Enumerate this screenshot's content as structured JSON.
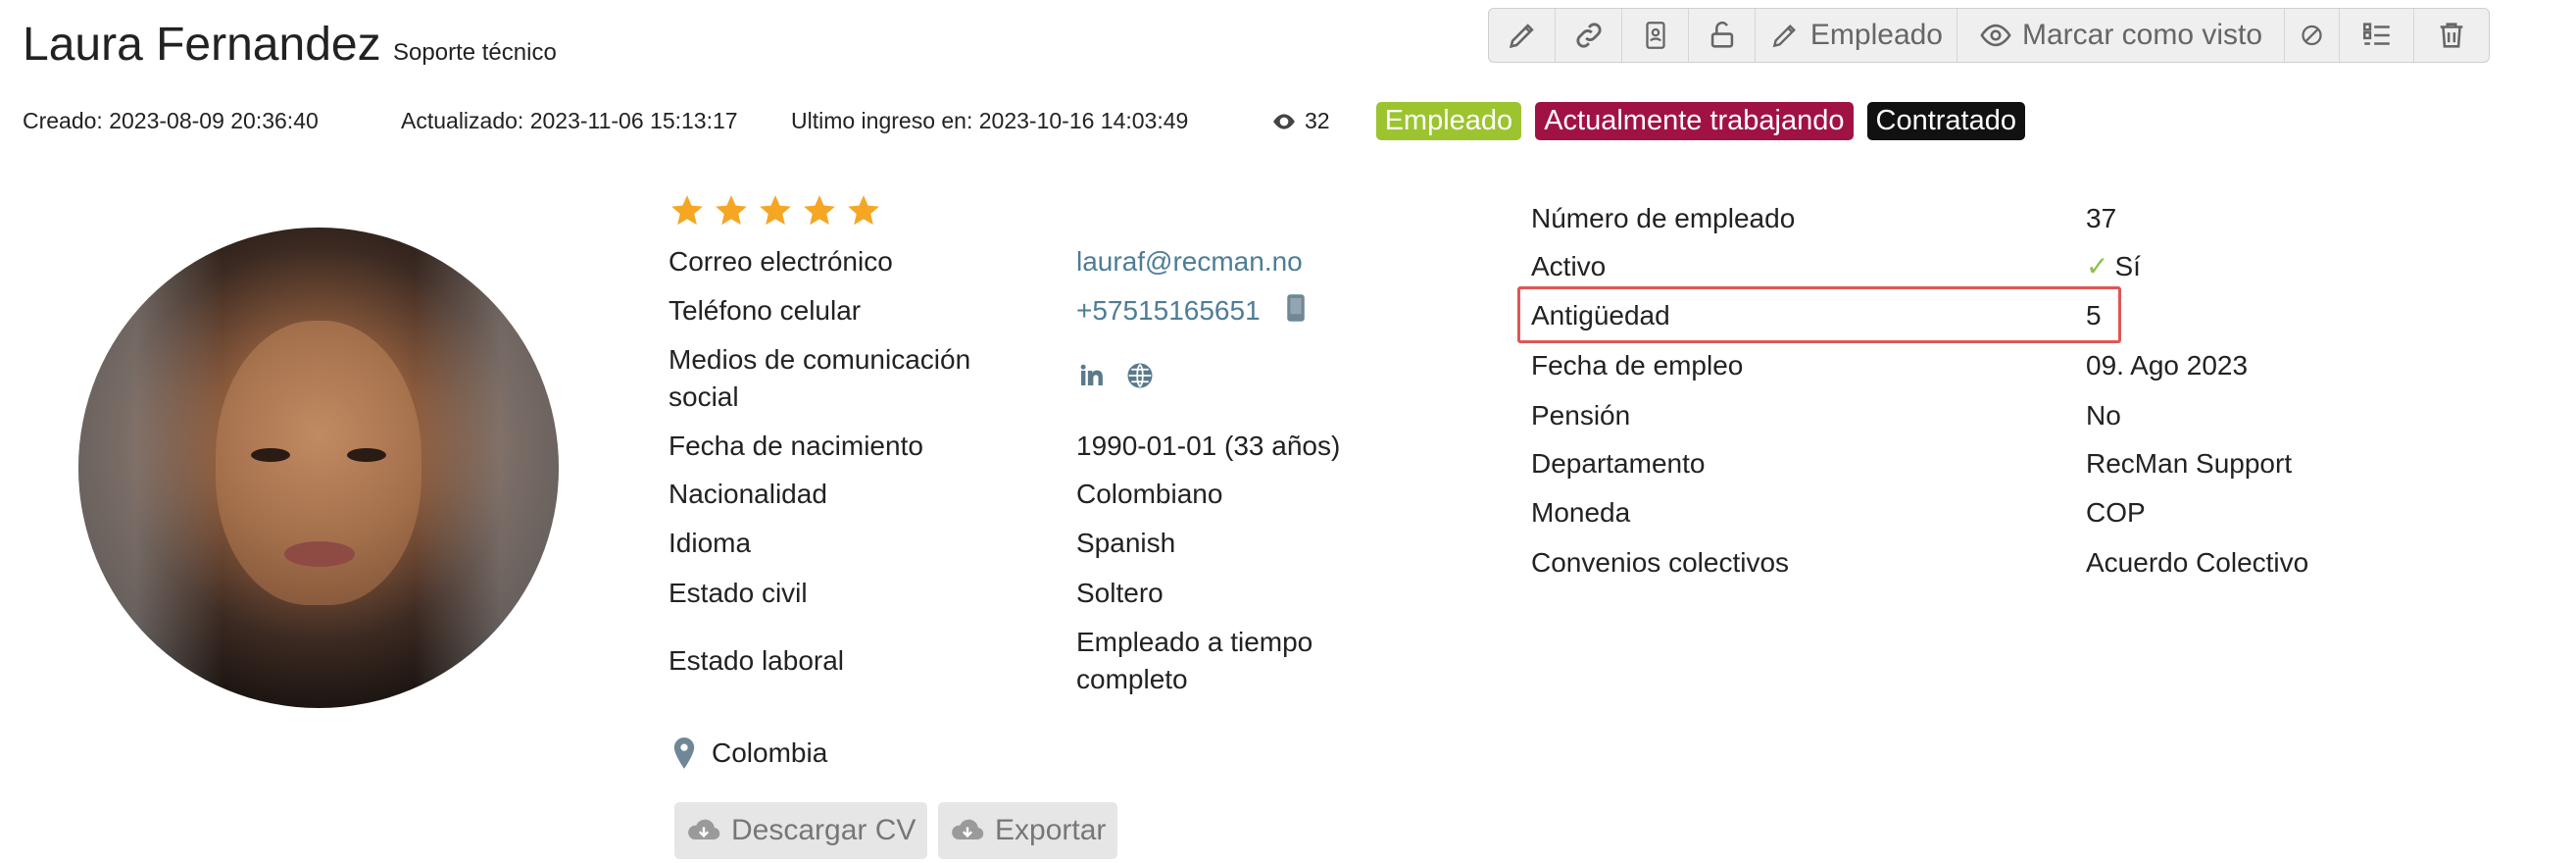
{
  "header": {
    "name": "Laura Fernandez",
    "subtitle": "Soporte técnico"
  },
  "toolbar": {
    "items": [
      {
        "icon": "pencil-icon"
      },
      {
        "icon": "link-icon"
      },
      {
        "icon": "contact-card-icon"
      },
      {
        "icon": "unlock-icon"
      },
      {
        "icon": "pencil-icon",
        "label": "Empleado"
      },
      {
        "icon": "eye-icon",
        "label": "Marcar como visto"
      },
      {
        "icon": "block-icon"
      },
      {
        "icon": "list-icon"
      },
      {
        "icon": "trash-icon"
      }
    ]
  },
  "meta": {
    "created": "Creado: 2023-08-09 20:36:40",
    "updated": "Actualizado: 2023-11-06 15:13:17",
    "last_login": "Ultimo ingreso en: 2023-10-16 14:03:49",
    "views": "32"
  },
  "badges": [
    {
      "label": "Empleado",
      "color": "#9cc42e"
    },
    {
      "label": "Actualmente trabajando",
      "color": "#a11244"
    },
    {
      "label": "Contratado",
      "color": "#111111"
    }
  ],
  "rating": {
    "value": 5,
    "max": 5,
    "color": "#f5a623"
  },
  "personal": {
    "email_label": "Correo electrónico",
    "email": "lauraf@recman.no",
    "phone_label": "Teléfono celular",
    "phone": "+57515165651",
    "social_label_1": "Medios de comunicación",
    "social_label_2": "social",
    "birth_label": "Fecha de nacimiento",
    "birth": "1990-01-01 (33 años)",
    "nationality_label": "Nacionalidad",
    "nationality": "Colombiano",
    "language_label": "Idioma",
    "language": "Spanish",
    "civil_label": "Estado civil",
    "civil": "Soltero",
    "work_status_label": "Estado laboral",
    "work_status_1": "Empleado a tiempo",
    "work_status_2": "completo"
  },
  "location": "Colombia",
  "employment": {
    "number_label": "Número de empleado",
    "number": "37",
    "active_label": "Activo",
    "active": "Sí",
    "seniority_label": "Antigüedad",
    "seniority": "5",
    "start_label": "Fecha de empleo",
    "start": "09. Ago 2023",
    "pension_label": "Pensión",
    "pension": "No",
    "department_label": "Departamento",
    "department": "RecMan Support",
    "currency_label": "Moneda",
    "currency": "COP",
    "agreements_label": "Convenios colectivos",
    "agreements": "Acuerdo Colectivo"
  },
  "actions": {
    "download_cv": "Descargar CV",
    "export": "Exportar"
  }
}
